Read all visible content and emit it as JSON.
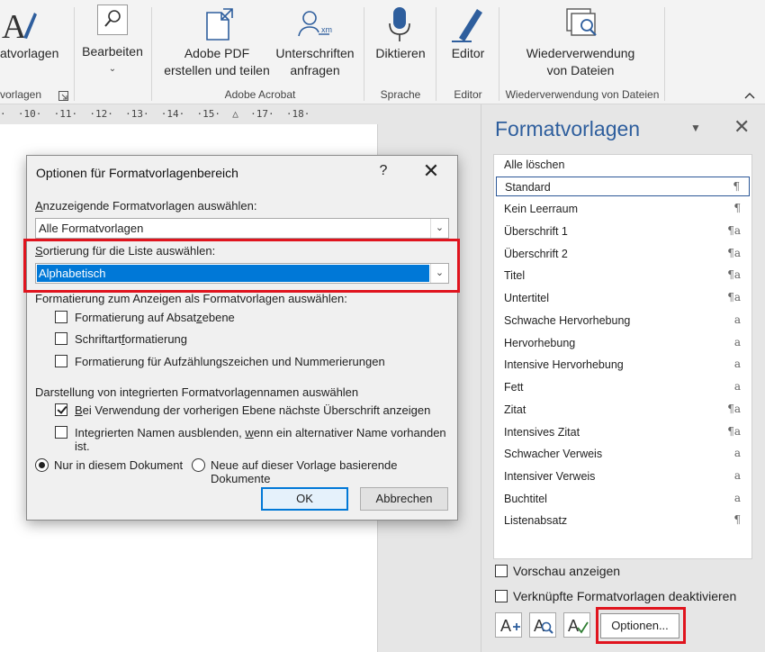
{
  "ribbon": {
    "styles_btn": "atvorlagen",
    "styles_group": "vorlagen",
    "edit_btn": "Bearbeiten",
    "pdf_btn_l1": "Adobe PDF",
    "pdf_btn_l2": "erstellen und teilen",
    "sign_btn_l1": "Unterschriften",
    "sign_btn_l2": "anfragen",
    "acrobat_group": "Adobe Acrobat",
    "dictate_btn": "Diktieren",
    "speech_group": "Sprache",
    "editor_btn": "Editor",
    "editor_group": "Editor",
    "reuse_btn_l1": "Wiederverwendung",
    "reuse_btn_l2": "von Dateien",
    "reuse_group": "Wiederverwendung von Dateien",
    "accent_color": "#2e5e9d"
  },
  "ruler": {
    "text": "·  ·10·  ·11·  ·12·  ·13·  ·14·  ·15·  △  ·17·  ·18·"
  },
  "dialog": {
    "title": "Optionen für Formatvorlagenbereich",
    "help": "?",
    "close": "✕",
    "show_label_a": "A",
    "show_label_rest": "nzuzeigende Formatvorlagen auswählen:",
    "show_value": "Alle Formatvorlagen",
    "sort_label_a": "S",
    "sort_label_rest": "ortierung für die Liste auswählen:",
    "sort_value": "Alphabetisch",
    "fmt_label": "Formatierung zum Anzeigen als Formatvorlagen auswählen:",
    "chk_para_a": "Formatierung auf Absat",
    "chk_para_u": "z",
    "chk_para_b": "ebene",
    "chk_font_a": "Schriftart",
    "chk_font_u": "f",
    "chk_font_b": "ormatierung",
    "chk_bullets": "Formatierung für Aufzählungszeichen und Nummerierungen",
    "builtin_label": "Darstellung von integrierten Formatvorlagennamen auswählen",
    "chk_next_u": "B",
    "chk_next_rest": "ei Verwendung der vorherigen Ebene nächste Überschrift anzeigen",
    "chk_hide_a": "Integrierten Namen ausblenden, ",
    "chk_hide_u": "w",
    "chk_hide_b": "enn ein alternativer Name vorhanden ist.",
    "radio_doc": "Nur in diesem Dokument",
    "radio_new": "Neue auf dieser Vorlage basierende Dokumente",
    "ok": "OK",
    "cancel": "Abbrechen",
    "highlight_color": "#e0141e",
    "selection_color": "#0078d7"
  },
  "pane": {
    "title": "Formatvorlagen",
    "menu": "▼",
    "close": "✕",
    "items": [
      {
        "label": "Alle löschen",
        "glyph": ""
      },
      {
        "label": "Standard",
        "glyph": "¶"
      },
      {
        "label": "Kein Leerraum",
        "glyph": "¶"
      },
      {
        "label": "Überschrift 1",
        "glyph": "¶a"
      },
      {
        "label": "Überschrift 2",
        "glyph": "¶a"
      },
      {
        "label": "Titel",
        "glyph": "¶a"
      },
      {
        "label": "Untertitel",
        "glyph": "¶a"
      },
      {
        "label": "Schwache Hervorhebung",
        "glyph": "a"
      },
      {
        "label": "Hervorhebung",
        "glyph": "a"
      },
      {
        "label": "Intensive Hervorhebung",
        "glyph": "a"
      },
      {
        "label": "Fett",
        "glyph": "a"
      },
      {
        "label": "Zitat",
        "glyph": "¶a"
      },
      {
        "label": "Intensives Zitat",
        "glyph": "¶a"
      },
      {
        "label": "Schwacher Verweis",
        "glyph": "a"
      },
      {
        "label": "Intensiver Verweis",
        "glyph": "a"
      },
      {
        "label": "Buchtitel",
        "glyph": "a"
      },
      {
        "label": "Listenabsatz",
        "glyph": "¶"
      }
    ],
    "preview_label": "Vorschau anzeigen",
    "linked_label": "Verknüpfte Formatvorlagen deaktivieren",
    "options_btn": "Optionen..."
  }
}
